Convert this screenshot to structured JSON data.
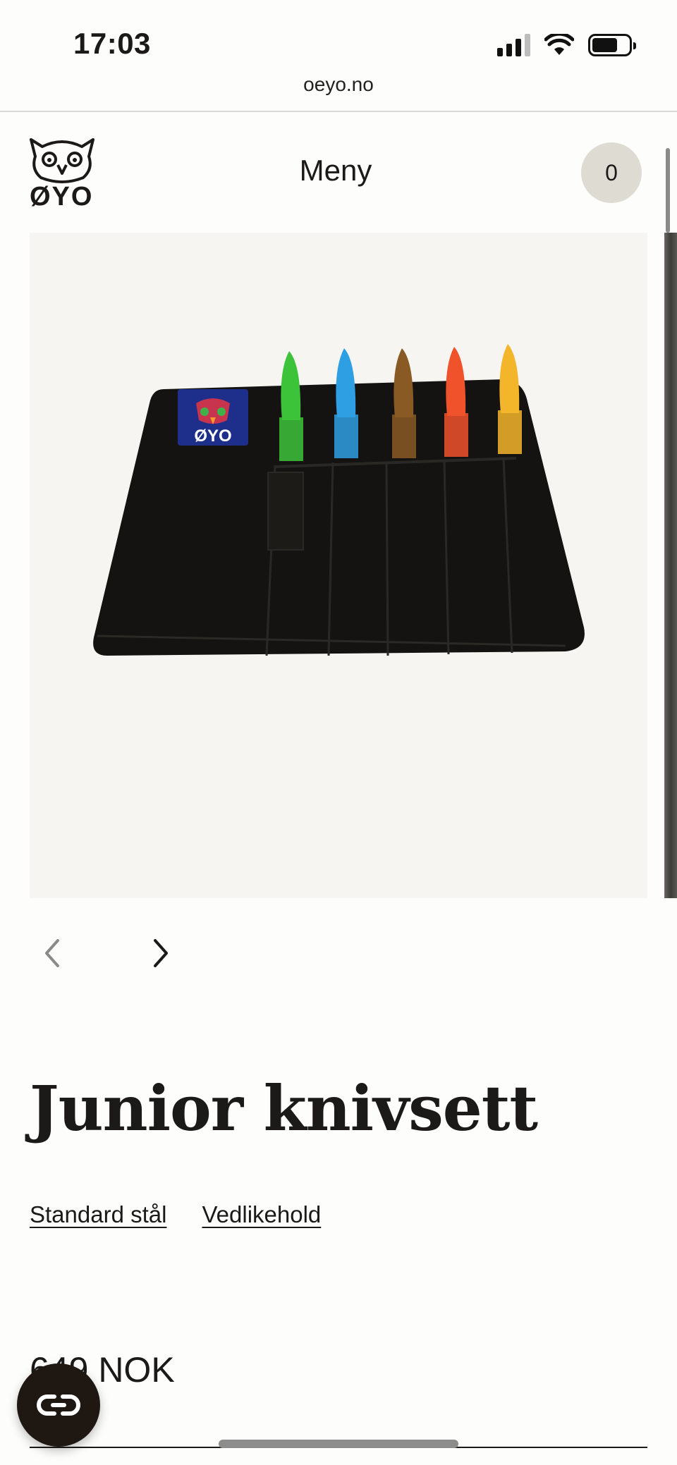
{
  "status_bar": {
    "time": "17:03"
  },
  "browser": {
    "url": "oeyo.no"
  },
  "header": {
    "logo_text": "ØYO",
    "menu_label": "Meny",
    "cart_count": "0"
  },
  "product": {
    "title": "Junior knivsett",
    "links": [
      {
        "label": "Standard stål"
      },
      {
        "label": "Vedlikehold"
      }
    ],
    "price": "649 NOK",
    "image": {
      "patch_text": "ØYO",
      "knife_colors": [
        "#3cc33a",
        "#2f9fe3",
        "#8a5a25",
        "#f0522c",
        "#f3b52a"
      ]
    }
  },
  "colors": {
    "background": "#fdfdfc",
    "cart_badge": "#dedcd2",
    "chat_button": "#1f1712"
  }
}
